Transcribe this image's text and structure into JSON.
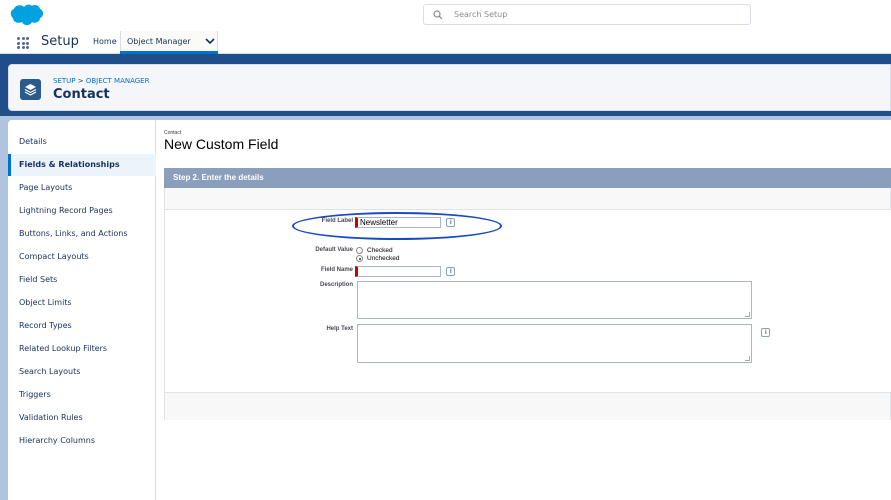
{
  "header": {
    "search_placeholder": "Search Setup"
  },
  "nav": {
    "app_name": "Setup",
    "home": "Home",
    "object_manager": "Object Manager"
  },
  "page_header": {
    "breadcrumb_setup": "SETUP",
    "breadcrumb_sep": ">",
    "breadcrumb_om": "OBJECT MANAGER",
    "title": "Contact"
  },
  "sidebar": {
    "items": [
      {
        "label": "Details"
      },
      {
        "label": "Fields & Relationships"
      },
      {
        "label": "Page Layouts"
      },
      {
        "label": "Lightning Record Pages"
      },
      {
        "label": "Buttons, Links, and Actions"
      },
      {
        "label": "Compact Layouts"
      },
      {
        "label": "Field Sets"
      },
      {
        "label": "Object Limits"
      },
      {
        "label": "Record Types"
      },
      {
        "label": "Related Lookup Filters"
      },
      {
        "label": "Search Layouts"
      },
      {
        "label": "Triggers"
      },
      {
        "label": "Validation Rules"
      },
      {
        "label": "Hierarchy Columns"
      }
    ],
    "active_index": 1
  },
  "content": {
    "crumb": "Contact",
    "title": "New Custom Field",
    "step_title": "Step 2. Enter the details",
    "fields": {
      "field_label": {
        "label": "Field Label",
        "value": "Newsletter"
      },
      "default_value": {
        "label": "Default Value",
        "options": [
          "Checked",
          "Unchecked"
        ],
        "selected": "Unchecked"
      },
      "field_name": {
        "label": "Field Name",
        "value": ""
      },
      "description": {
        "label": "Description",
        "value": ""
      },
      "help_text": {
        "label": "Help Text",
        "value": ""
      }
    },
    "info_glyph": "i"
  },
  "colors": {
    "brand_blue": "#0070d2",
    "header_band": "#1f4e8a",
    "step_bar": "#8a9ebe",
    "required": "#cc0000",
    "highlight": "#1a49c4"
  }
}
